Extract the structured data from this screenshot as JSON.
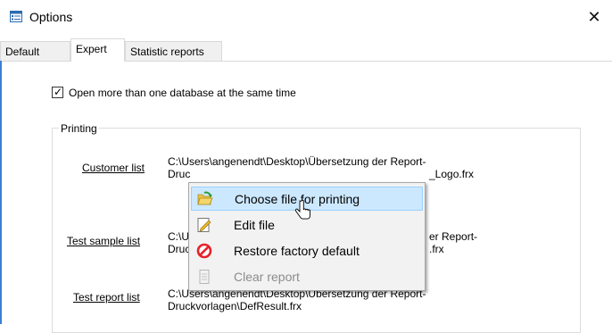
{
  "window": {
    "title": "Options",
    "close_glyph": "✕"
  },
  "tabs": [
    {
      "label": "Default",
      "active": false
    },
    {
      "label": "Expert",
      "active": true
    },
    {
      "label": "Statistic reports",
      "active": false
    }
  ],
  "options": {
    "multi_db_label": "Open more than one database at the same time",
    "multi_db_checked": true
  },
  "printing": {
    "group_label": "Printing",
    "rows": [
      {
        "link": "Customer list",
        "path_line1": "C:\\Users\\angenendt\\Desktop\\Übersetzung der Report-",
        "path_line2": "Druckvorlagen\\DefKundenliste_Logo.frx",
        "line2_visible_left": "Druc",
        "line2_visible_right": "_Logo.frx"
      },
      {
        "link": "Test sample list",
        "path_line1_left": "C:\\U",
        "path_line1_right": "er Report-",
        "path_line2_left": "Druc",
        "path_line2_right": ".frx"
      },
      {
        "link": "Test report list",
        "path_line1": "C:\\Users\\angenendt\\Desktop\\Übersetzung der Report-",
        "path_line2": "Druckvorlagen\\DefResult.frx"
      }
    ]
  },
  "context_menu": {
    "items": [
      {
        "label": "Choose file for printing",
        "icon": "folder-open-icon",
        "highlighted": true,
        "enabled": true
      },
      {
        "label": "Edit file",
        "icon": "edit-file-icon",
        "highlighted": false,
        "enabled": true
      },
      {
        "label": "Restore factory default",
        "icon": "restore-icon",
        "highlighted": false,
        "enabled": true
      },
      {
        "label": "Clear report",
        "icon": "clear-report-icon",
        "highlighted": false,
        "enabled": false
      }
    ]
  },
  "colors": {
    "menu_highlight": "#cce8ff",
    "menu_highlight_border": "#99d1ff",
    "accent": "#3c7fd1",
    "restore_red": "#e8202a"
  }
}
